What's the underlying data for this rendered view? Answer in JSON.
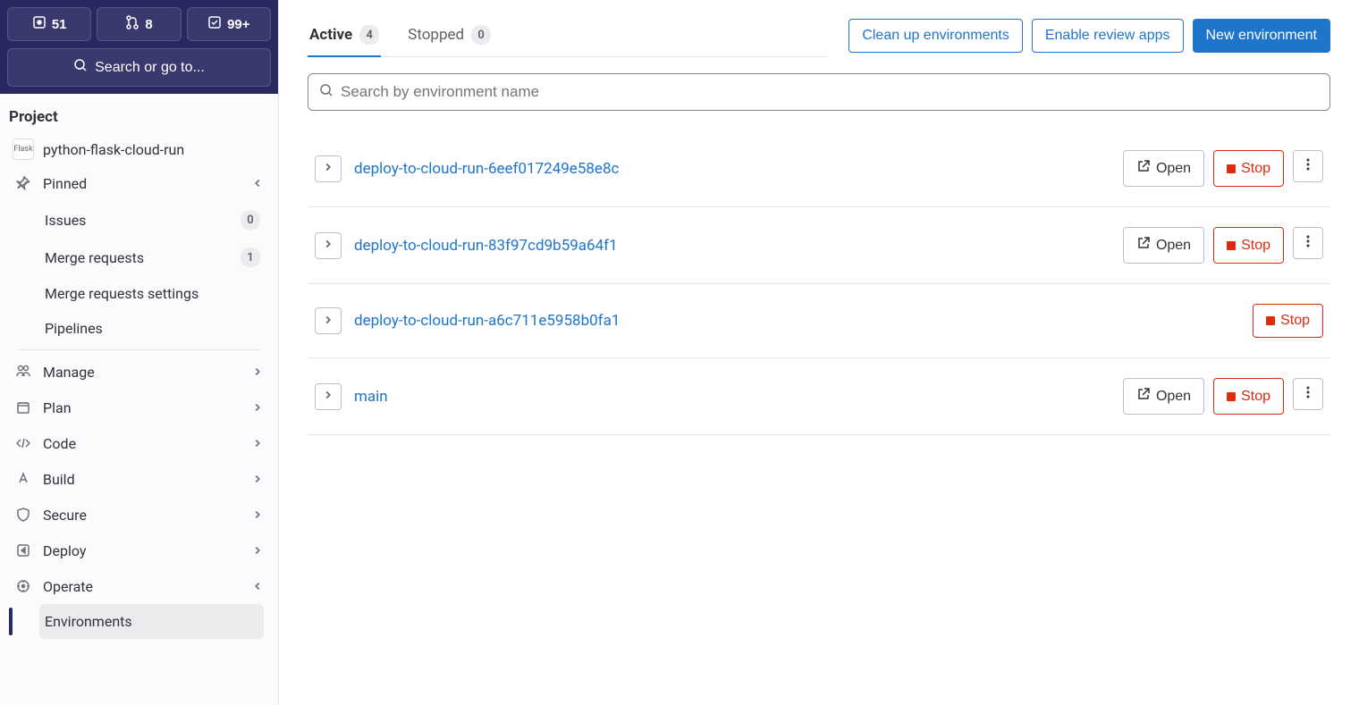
{
  "topCounters": {
    "issues": "51",
    "mrs": "8",
    "todos": "99+"
  },
  "searchBtn": "Search or go to...",
  "sidebar": {
    "sectionTitle": "Project",
    "projectName": "python-flask-cloud-run",
    "pinned": {
      "label": "Pinned",
      "items": [
        {
          "label": "Issues",
          "count": "0"
        },
        {
          "label": "Merge requests",
          "count": "1"
        },
        {
          "label": "Merge requests settings"
        },
        {
          "label": "Pipelines"
        }
      ]
    },
    "nav": [
      {
        "label": "Manage"
      },
      {
        "label": "Plan"
      },
      {
        "label": "Code"
      },
      {
        "label": "Build"
      },
      {
        "label": "Secure"
      },
      {
        "label": "Deploy"
      },
      {
        "label": "Operate",
        "expanded": true,
        "children": [
          {
            "label": "Environments",
            "active": true
          }
        ]
      }
    ]
  },
  "tabs": {
    "active": {
      "label": "Active",
      "count": "4"
    },
    "stopped": {
      "label": "Stopped",
      "count": "0"
    }
  },
  "actions": {
    "cleanup": "Clean up environments",
    "enableReview": "Enable review apps",
    "newEnv": "New environment"
  },
  "search": {
    "placeholder": "Search by environment name"
  },
  "buttons": {
    "open": "Open",
    "stop": "Stop"
  },
  "environments": [
    {
      "name": "deploy-to-cloud-run-6eef017249e58e8c",
      "open": true,
      "stop": true,
      "menu": true
    },
    {
      "name": "deploy-to-cloud-run-83f97cd9b59a64f1",
      "open": true,
      "stop": true,
      "menu": true
    },
    {
      "name": "deploy-to-cloud-run-a6c711e5958b0fa1",
      "open": false,
      "stop": true,
      "menu": false
    },
    {
      "name": "main",
      "open": true,
      "stop": true,
      "menu": true
    }
  ]
}
